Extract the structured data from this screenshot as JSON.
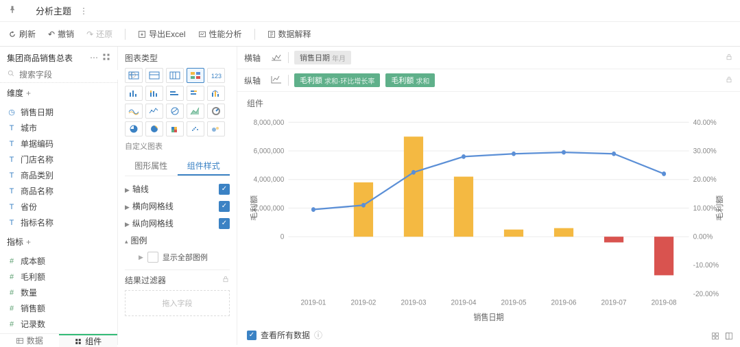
{
  "header": {
    "title": "分析主题"
  },
  "toolbar": {
    "refresh": "刷新",
    "undo": "撤销",
    "redo": "还原",
    "export": "导出Excel",
    "perf": "性能分析",
    "explain": "数据解释"
  },
  "sidebar": {
    "dataset": "集团商品销售总表",
    "search_placeholder": "搜索字段",
    "dims_label": "维度",
    "dims": [
      {
        "icon": "clock",
        "label": "销售日期"
      },
      {
        "icon": "T",
        "label": "城市"
      },
      {
        "icon": "T",
        "label": "单据编码"
      },
      {
        "icon": "T",
        "label": "门店名称"
      },
      {
        "icon": "T",
        "label": "商品类别"
      },
      {
        "icon": "T",
        "label": "商品名称"
      },
      {
        "icon": "T",
        "label": "省份"
      },
      {
        "icon": "T",
        "label": "指标名称"
      }
    ],
    "metrics_label": "指标",
    "metrics": [
      {
        "label": "成本额"
      },
      {
        "label": "毛利额"
      },
      {
        "label": "数量"
      },
      {
        "label": "销售额"
      },
      {
        "label": "记录数"
      }
    ],
    "tabs": {
      "data": "数据",
      "comp": "组件"
    }
  },
  "config": {
    "chart_type_label": "图表类型",
    "custom_chart": "自定义图表",
    "tabs": {
      "shape": "图形属性",
      "style": "组件样式"
    },
    "props": {
      "axis_line": "轴线",
      "hgrid": "横向网格线",
      "vgrid": "纵向网格线",
      "legend": "图例",
      "legend_all": "显示全部图例"
    },
    "filter_label": "结果过滤器",
    "dropzone": "拖入字段"
  },
  "axes": {
    "x_label": "横轴",
    "y_label": "纵轴",
    "x_pill": {
      "main": "销售日期",
      "suffix": "年月"
    },
    "y_pills": [
      {
        "main": "毛利额",
        "suffix": "求和-环比增长率"
      },
      {
        "main": "毛利额",
        "suffix": "求和"
      }
    ],
    "comp_label": "组件"
  },
  "viewall": {
    "label": "查看所有数据"
  },
  "chart_data": {
    "type": "combo",
    "categories": [
      "2019-01",
      "2019-02",
      "2019-03",
      "2019-04",
      "2019-05",
      "2019-06",
      "2019-07",
      "2019-08"
    ],
    "x_title": "销售日期",
    "series": [
      {
        "name": "毛利额(求和)",
        "type": "bar",
        "axis": "left",
        "values": [
          0,
          3800000,
          7000000,
          4200000,
          500000,
          600000,
          -400000,
          -2700000
        ]
      },
      {
        "name": "毛利额(环比增长率)",
        "type": "line",
        "axis": "right",
        "values": [
          0.095,
          0.11,
          0.225,
          0.28,
          0.29,
          0.295,
          0.29,
          0.22
        ]
      }
    ],
    "y_left": {
      "label": "毛利额",
      "ticks": [
        8000000,
        6000000,
        4000000,
        2000000,
        0
      ]
    },
    "y_right": {
      "label": "毛利额",
      "ticks": [
        0.4,
        0.3,
        0.2,
        0.1,
        0.0,
        -0.1,
        -0.2
      ]
    }
  }
}
